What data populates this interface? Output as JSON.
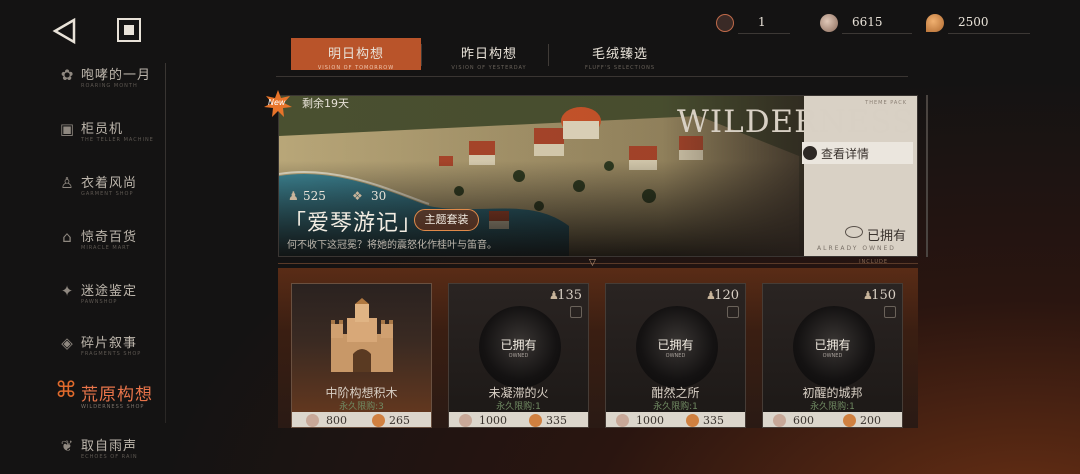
{
  "system": {
    "back_icon": "back-triangle-icon",
    "home_icon": "home-square-icon"
  },
  "sidebar": {
    "items": [
      {
        "label": "咆哮的一月",
        "sub": "ROARING MONTH",
        "icon": "paw-icon"
      },
      {
        "label": "柜员机",
        "sub": "THE TELLER MACHINE",
        "icon": "teller-icon"
      },
      {
        "label": "衣着风尚",
        "sub": "GARMENT SHOP",
        "icon": "clothes-icon"
      },
      {
        "label": "惊奇百货",
        "sub": "MIRACLE MART",
        "icon": "mart-icon"
      },
      {
        "label": "迷途鉴定",
        "sub": "PAWNSHOP",
        "icon": "pawn-icon"
      },
      {
        "label": "碎片叙事",
        "sub": "FRAGMENTS SHOP",
        "icon": "fragment-icon"
      },
      {
        "label": "荒原构想",
        "sub": "WILDERNESS SHOP",
        "icon": "wilderness-icon",
        "active": true
      },
      {
        "label": "取自雨声",
        "sub": "ECHOES OF RAIN",
        "icon": "rain-icon"
      }
    ]
  },
  "currency": [
    {
      "icon": "ticket-icon",
      "value": "1"
    },
    {
      "icon": "shell-icon",
      "value": "6615"
    },
    {
      "icon": "leaf-coin-icon",
      "value": "2500"
    }
  ],
  "tabs": [
    {
      "label": "明日构想",
      "sub": "VISION OF TOMORROW",
      "active": true
    },
    {
      "label": "昨日构想",
      "sub": "VISION OF YESTERDAY",
      "active": false
    },
    {
      "label": "毛绒臻选",
      "sub": "FLUFF'S SELECTIONS",
      "active": false
    }
  ],
  "banner": {
    "new_badge": "New",
    "days_left": "剩余19天",
    "title_art": "WILDERNESS",
    "theme_pack": "THEME PACK",
    "detail_button": "查看详情",
    "stat_a": "525",
    "stat_b": "30",
    "pack_name": "「爱琴游记」",
    "pack_tag": "主题套装",
    "description": "何不收下这冠冕？将她的震怒化作桂叶与笛音。",
    "owned": "已拥有",
    "owned_sub": "ALREADY OWNED",
    "include_label": "INCLUDE"
  },
  "cards": [
    {
      "name": "中阶构想积木",
      "limit": "永久限购:3",
      "owned": false,
      "top_price": "",
      "bottom": [
        "800",
        "265"
      ]
    },
    {
      "name": "未凝滞的火",
      "limit": "永久限购:1",
      "owned": true,
      "owned_label": "已拥有",
      "owned_sub": "OWNED",
      "top_price": "135",
      "bottom": [
        "1000",
        "335"
      ]
    },
    {
      "name": "酣然之所",
      "limit": "永久限购:1",
      "owned": true,
      "owned_label": "已拥有",
      "owned_sub": "OWNED",
      "top_price": "120",
      "bottom": [
        "1000",
        "335"
      ]
    },
    {
      "name": "初醒的城邦",
      "limit": "永久限购:1",
      "owned": true,
      "owned_label": "已拥有",
      "owned_sub": "OWNED",
      "top_price": "150",
      "bottom": [
        "600",
        "200"
      ]
    }
  ],
  "colors": {
    "accent": "#b9542a",
    "active_text": "#e8744a",
    "limit_green": "#6f8a62"
  }
}
